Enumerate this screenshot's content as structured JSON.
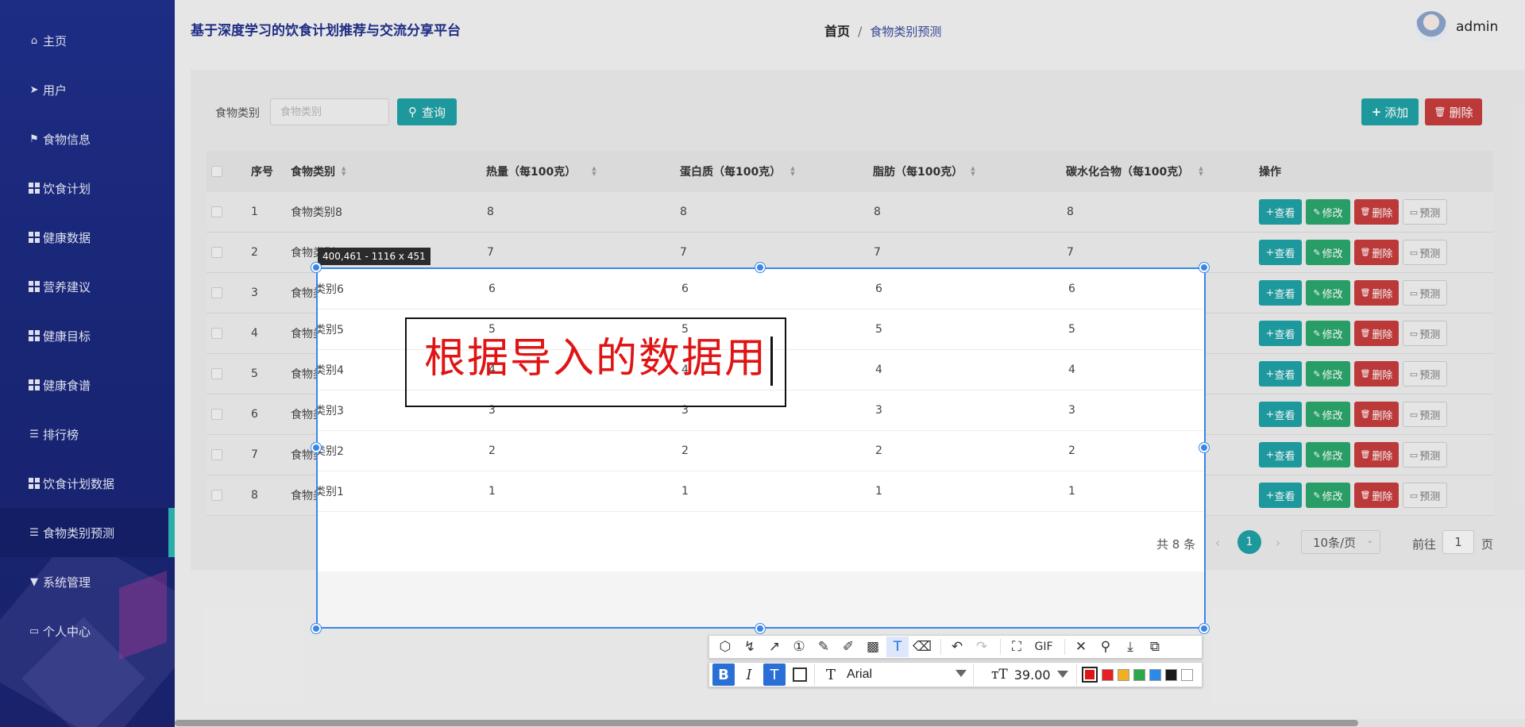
{
  "sidebar": {
    "items": [
      {
        "label": "主页",
        "icon": "home-icon",
        "active": false
      },
      {
        "label": "用户",
        "icon": "send-icon",
        "active": false
      },
      {
        "label": "食物信息",
        "icon": "flag-icon",
        "active": false
      },
      {
        "label": "饮食计划",
        "icon": "grid-icon",
        "active": false
      },
      {
        "label": "健康数据",
        "icon": "grid-icon",
        "active": false
      },
      {
        "label": "营养建议",
        "icon": "grid-icon",
        "active": false
      },
      {
        "label": "健康目标",
        "icon": "grid-icon",
        "active": false
      },
      {
        "label": "健康食谱",
        "icon": "grid-icon",
        "active": false
      },
      {
        "label": "排行榜",
        "icon": "list-icon",
        "active": false
      },
      {
        "label": "饮食计划数据",
        "icon": "grid-icon",
        "active": false
      },
      {
        "label": "食物类别预测",
        "icon": "list-icon",
        "active": true
      },
      {
        "label": "系统管理",
        "icon": "pin-icon",
        "active": false
      },
      {
        "label": "个人中心",
        "icon": "card-icon",
        "active": false
      }
    ]
  },
  "header": {
    "site_title": "基于深度学习的饮食计划推荐与交流分享平台",
    "breadcrumb_home": "首页",
    "breadcrumb_sep": "/",
    "breadcrumb_current": "食物类别预测",
    "username": "admin"
  },
  "search": {
    "label": "食物类别",
    "placeholder": "食物类别",
    "query_button": "查询",
    "add_button": "添加",
    "delete_button": "删除"
  },
  "table": {
    "columns": [
      "序号",
      "食物类别",
      "热量（每100克）",
      "蛋白质（每100克）",
      "脂肪（每100克）",
      "碳水化合物（每100克）",
      "操作"
    ],
    "rows": [
      {
        "no": "1",
        "cat": "食物类别8",
        "heat": "8",
        "protein": "8",
        "fat": "8",
        "carb": "8"
      },
      {
        "no": "2",
        "cat": "食物类别7",
        "heat": "7",
        "protein": "7",
        "fat": "7",
        "carb": "7"
      },
      {
        "no": "3",
        "cat": "食物类别6",
        "heat": "6",
        "protein": "6",
        "fat": "6",
        "carb": "6"
      },
      {
        "no": "4",
        "cat": "食物类别5",
        "heat": "5",
        "protein": "5",
        "fat": "5",
        "carb": "5"
      },
      {
        "no": "5",
        "cat": "食物类别4",
        "heat": "4",
        "protein": "4",
        "fat": "4",
        "carb": "4"
      },
      {
        "no": "6",
        "cat": "食物类别3",
        "heat": "3",
        "protein": "3",
        "fat": "3",
        "carb": "3"
      },
      {
        "no": "7",
        "cat": "食物类别2",
        "heat": "2",
        "protein": "2",
        "fat": "2",
        "carb": "2"
      },
      {
        "no": "8",
        "cat": "食物类别1",
        "heat": "1",
        "protein": "1",
        "fat": "1",
        "carb": "1"
      }
    ],
    "row_actions": {
      "view": "查看",
      "edit": "修改",
      "delete": "删除",
      "predict": "预测"
    }
  },
  "pagination": {
    "total": "共 8 条",
    "current_page": "1",
    "page_size": "10条/页",
    "goto_label": "前往",
    "goto_value": "1",
    "page_suffix": "页"
  },
  "screenshot_tool": {
    "size_tip": "400,461 - 1116 x 451",
    "annotation_text": "根据导入的数据用",
    "font_name": "Arial",
    "font_size": "39.00",
    "gif_label": "GIF",
    "colors": [
      "#e01414",
      "#e82020",
      "#f0b020",
      "#2aa84a",
      "#2a8ae8",
      "#1a1a1a",
      "#ffffff"
    ]
  }
}
